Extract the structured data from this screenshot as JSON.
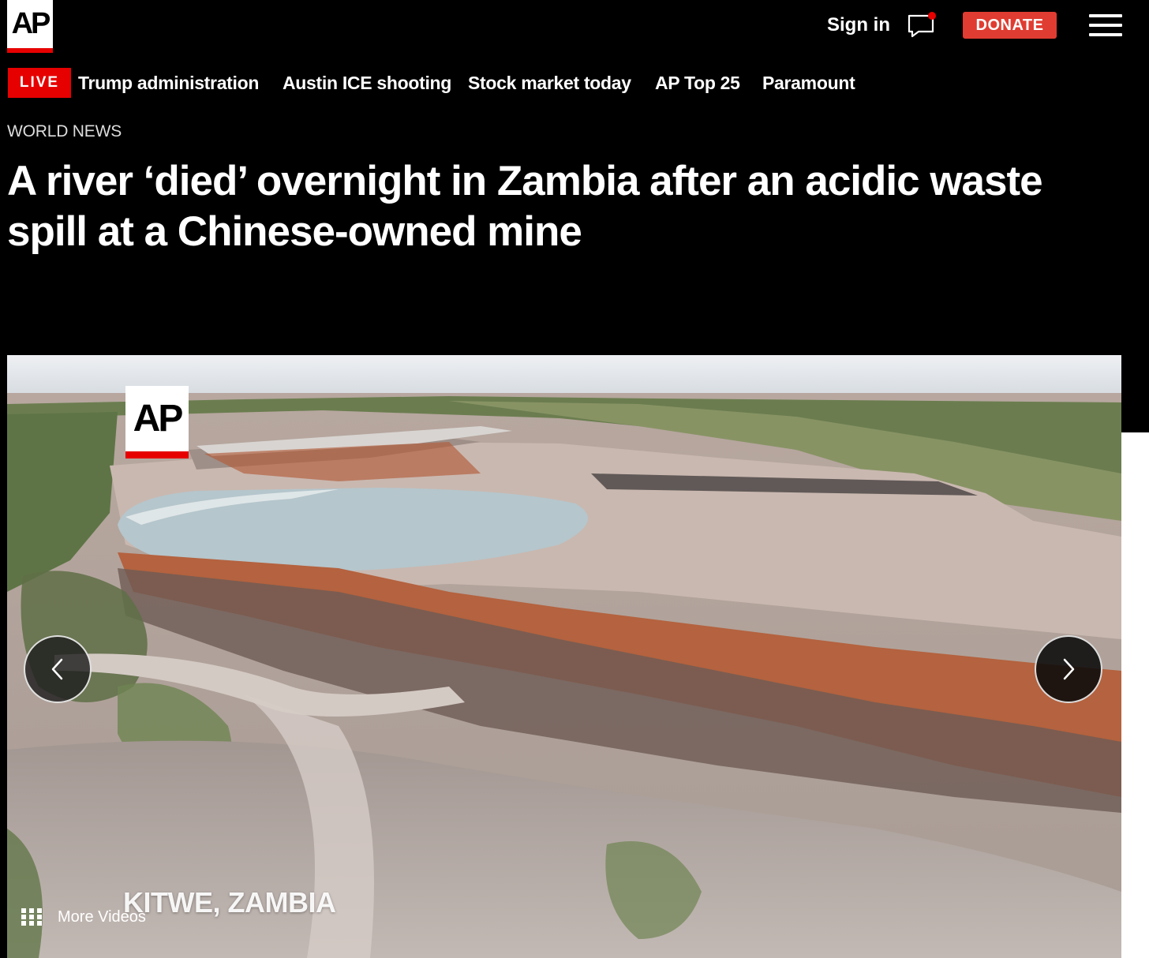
{
  "header": {
    "logo_text": "AP",
    "sign_in": "Sign in",
    "donate": "DONATE",
    "icons": [
      "chat-bubble-icon",
      "notification-dot",
      "menu-icon"
    ],
    "colors": {
      "accent_red": "#e03c31",
      "live_red": "#e60000"
    }
  },
  "trending": {
    "live_label": "LIVE",
    "items": [
      "Trump administration",
      "Austin ICE shooting",
      "Stock market today",
      "AP Top 25",
      "Paramount"
    ]
  },
  "article": {
    "section": "WORLD NEWS",
    "headline": "A river ‘died’ overnight in Zambia after an acidic waste spill at a Chinese-owned mine"
  },
  "video": {
    "watermark": "AP",
    "location_caption": "KITWE, ZAMBIA",
    "more_videos": "More Videos",
    "icons": [
      "chevron-left-icon",
      "chevron-right-icon",
      "grid-icon"
    ]
  }
}
